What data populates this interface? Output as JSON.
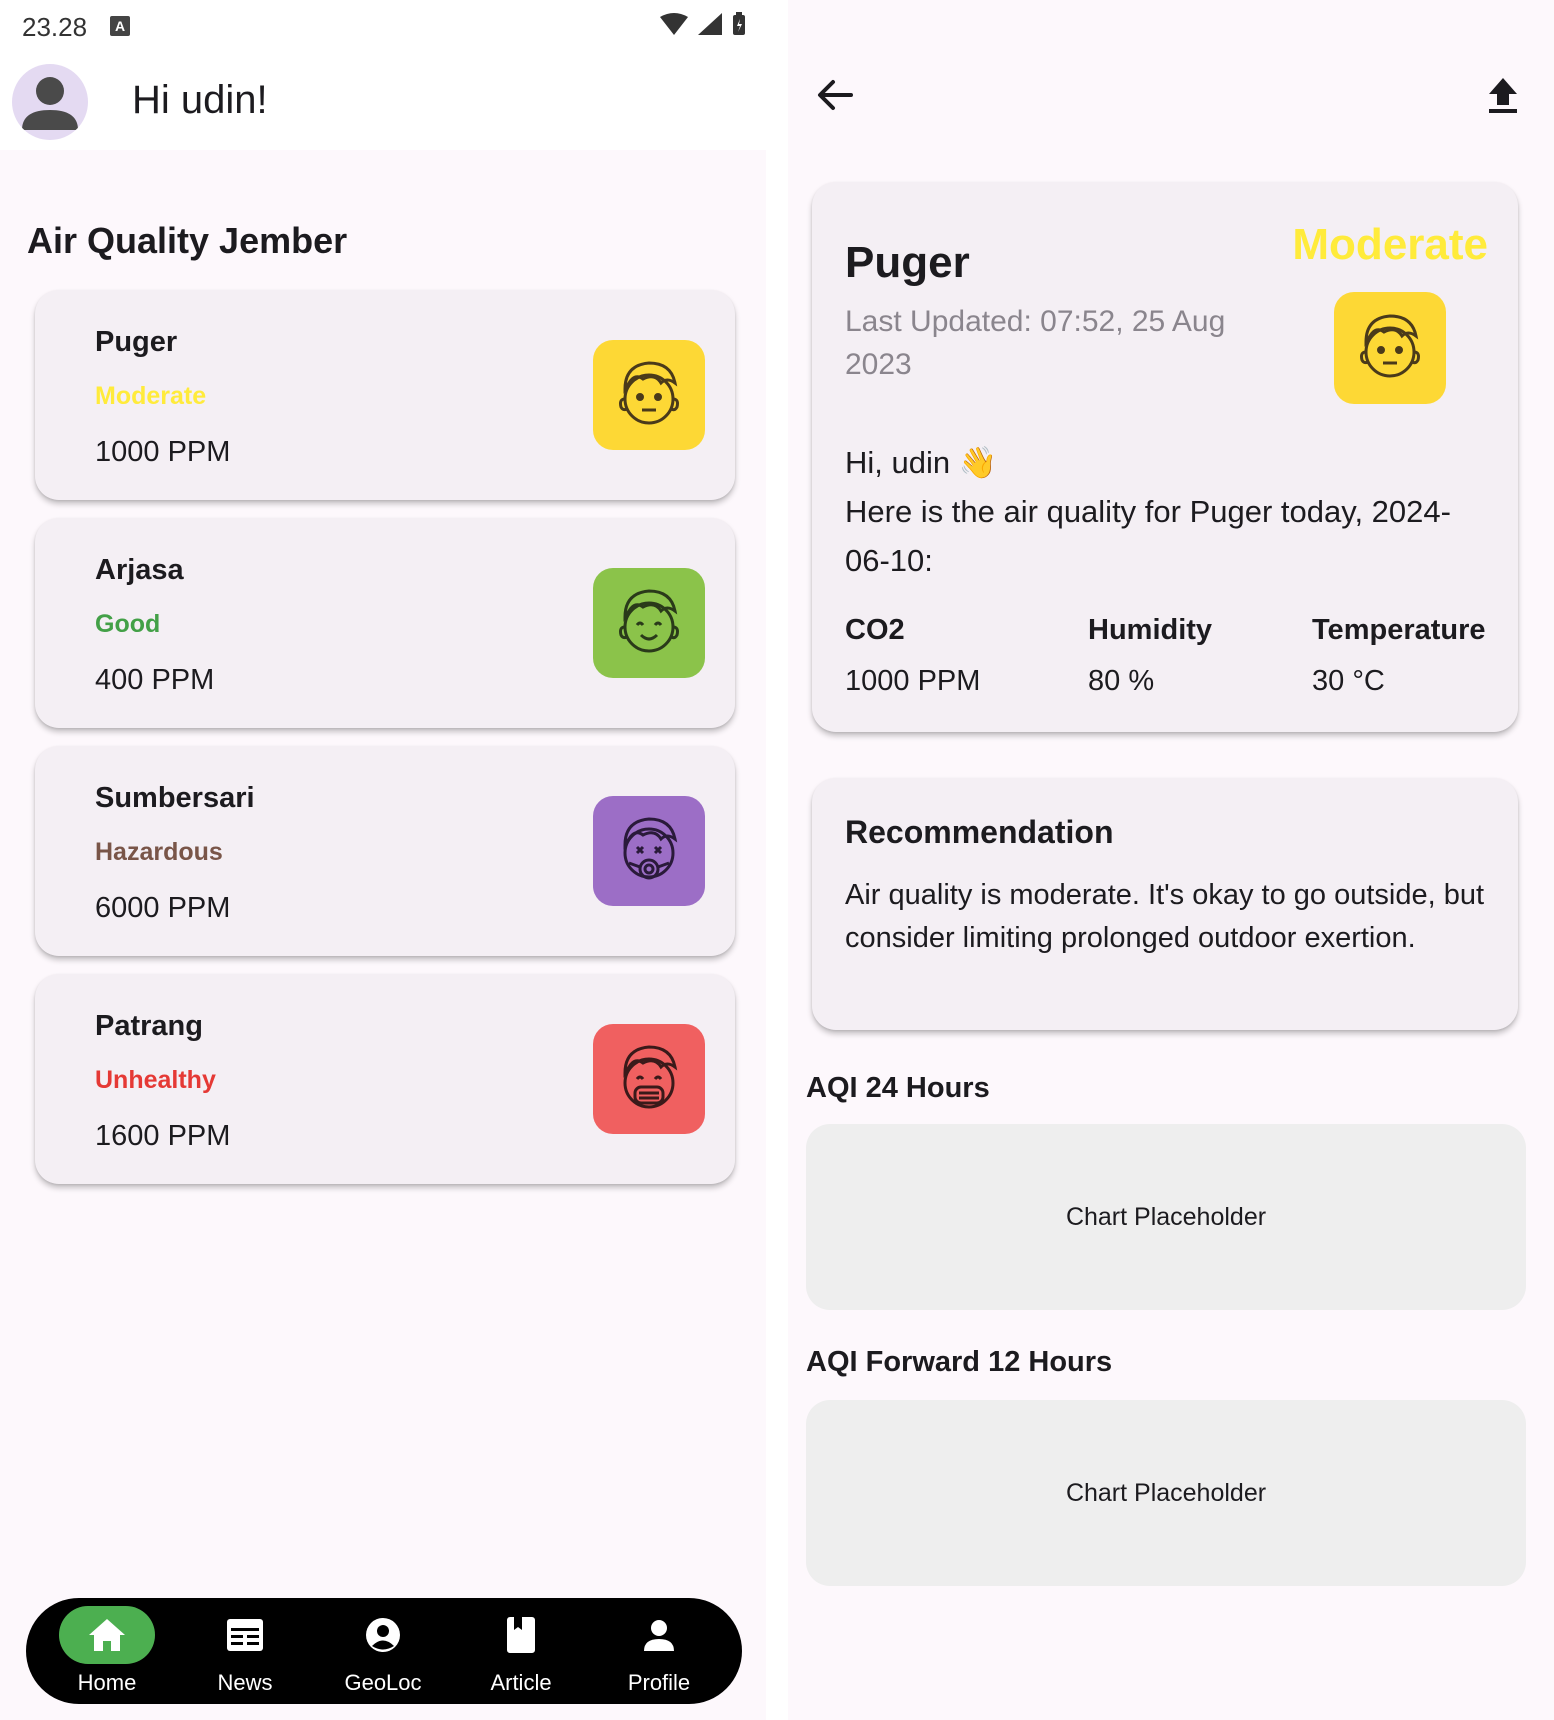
{
  "left": {
    "status_time": "23.28",
    "status_notif": "A",
    "greeting": "Hi udin!",
    "section_title": "Air Quality Jember",
    "locations": [
      {
        "name": "Puger",
        "status": "Moderate",
        "ppm": "1000 PPM",
        "status_color": "#ffeb3b",
        "face_color": "#fdd835",
        "face_icon": "neutral-face-icon"
      },
      {
        "name": "Arjasa",
        "status": "Good",
        "ppm": "400 PPM",
        "status_color": "#43a047",
        "face_color": "#8bc34a",
        "face_icon": "smile-face-icon"
      },
      {
        "name": "Sumbersari",
        "status": "Hazardous",
        "ppm": "6000 PPM",
        "status_color": "#795548",
        "face_color": "#9c6ec6",
        "face_icon": "gas-mask-face-icon"
      },
      {
        "name": "Patrang",
        "status": "Unhealthy",
        "ppm": "1600 PPM",
        "status_color": "#e53935",
        "face_color": "#f06060",
        "face_icon": "face-mask-icon"
      }
    ],
    "nav": [
      {
        "label": "Home",
        "icon": "home-icon",
        "active": true
      },
      {
        "label": "News",
        "icon": "news-icon",
        "active": false
      },
      {
        "label": "GeoLoc",
        "icon": "geoloc-icon",
        "active": false
      },
      {
        "label": "Article",
        "icon": "article-icon",
        "active": false
      },
      {
        "label": "Profile",
        "icon": "profile-icon",
        "active": false
      }
    ]
  },
  "right": {
    "detail": {
      "name": "Puger",
      "status": "Moderate",
      "last_updated": "Last Updated: 07:52, 25 Aug 2023",
      "greeting_line1": "Hi, udin 👋",
      "greeting_line2": "Here is the air quality for Puger today, 2024-06-10:",
      "metrics": [
        {
          "label": "CO2",
          "value": "1000 PPM"
        },
        {
          "label": "Humidity",
          "value": "80 %"
        },
        {
          "label": "Temperature",
          "value": "30 °C"
        }
      ]
    },
    "recommendation": {
      "title": "Recommendation",
      "text": "Air quality is moderate. It's okay to go outside, but consider limiting prolonged outdoor exertion."
    },
    "charts": [
      {
        "title": "AQI 24 Hours",
        "placeholder": "Chart Placeholder"
      },
      {
        "title": "AQI Forward 12 Hours",
        "placeholder": "Chart Placeholder"
      }
    ]
  }
}
